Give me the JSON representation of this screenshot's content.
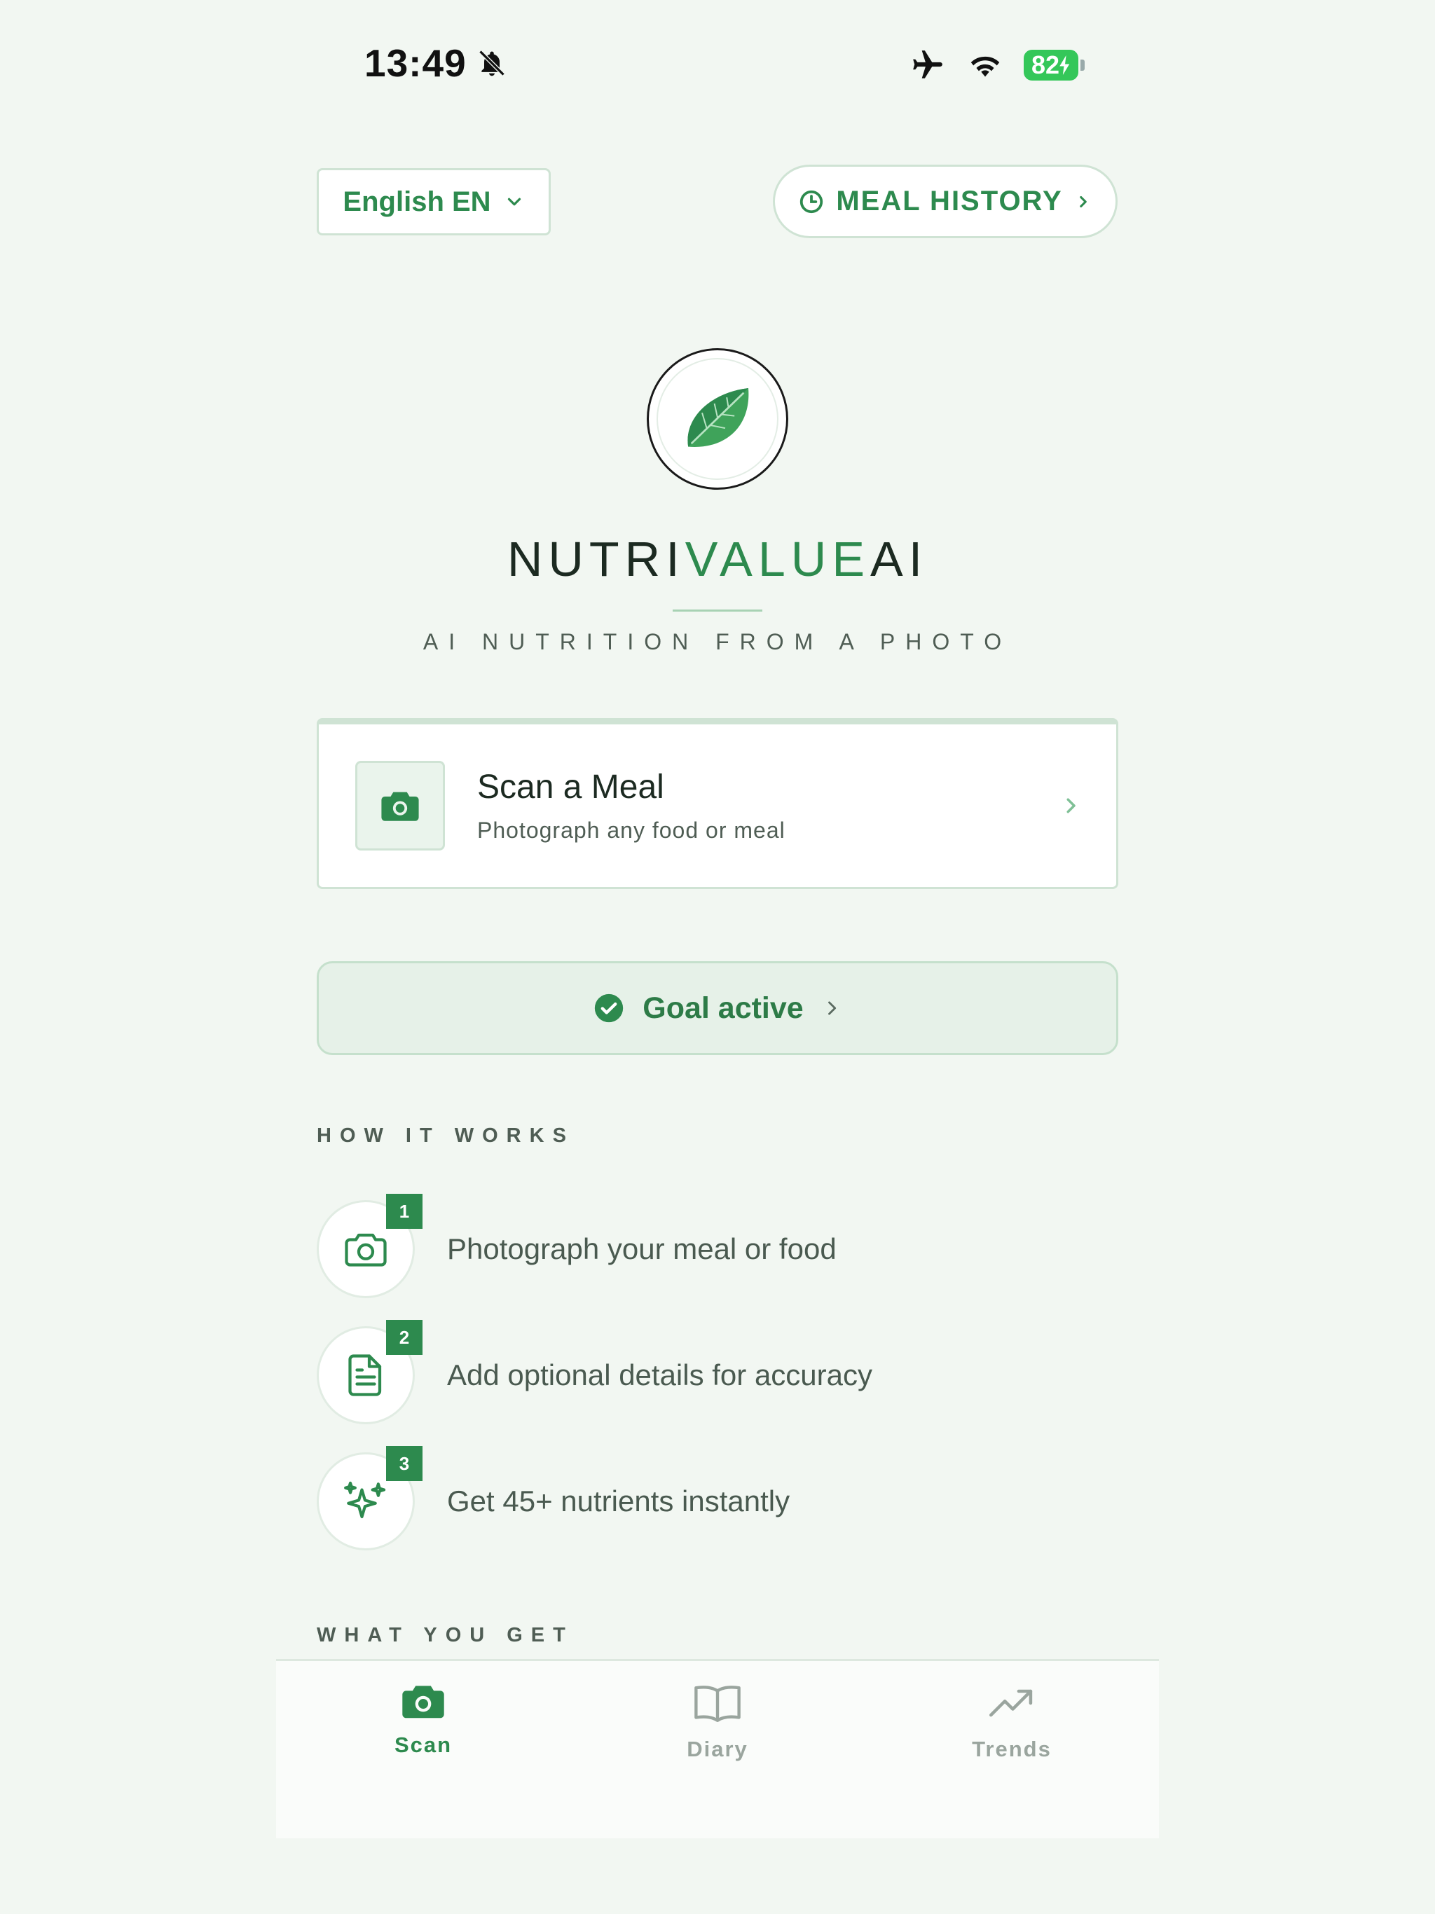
{
  "status_bar": {
    "time": "13:49",
    "battery": "82"
  },
  "header": {
    "language_label": "English EN",
    "history_label": "MEAL HISTORY"
  },
  "brand": {
    "name_part1": "NUTRI",
    "name_part2": "VALUE",
    "name_part3": "AI",
    "tagline": "AI NUTRITION FROM A PHOTO"
  },
  "scan_card": {
    "title": "Scan a Meal",
    "subtitle": "Photograph any food or meal"
  },
  "goal": {
    "label": "Goal active"
  },
  "how_it_works": {
    "title": "HOW IT WORKS",
    "steps": [
      {
        "number": "1",
        "text": "Photograph your meal or food",
        "icon": "camera-icon"
      },
      {
        "number": "2",
        "text": "Add optional details for accuracy",
        "icon": "document-icon"
      },
      {
        "number": "3",
        "text": "Get 45+ nutrients instantly",
        "icon": "sparkles-icon"
      }
    ]
  },
  "what_you_get": {
    "title": "WHAT YOU GET"
  },
  "tabs": [
    {
      "label": "Scan",
      "icon": "camera-icon",
      "active": true
    },
    {
      "label": "Diary",
      "icon": "book-icon",
      "active": false
    },
    {
      "label": "Trends",
      "icon": "trending-up-icon",
      "active": false
    }
  ],
  "colors": {
    "accent": "#2d8a4e",
    "background": "#f2f7f2",
    "border": "#cfe3d4"
  }
}
